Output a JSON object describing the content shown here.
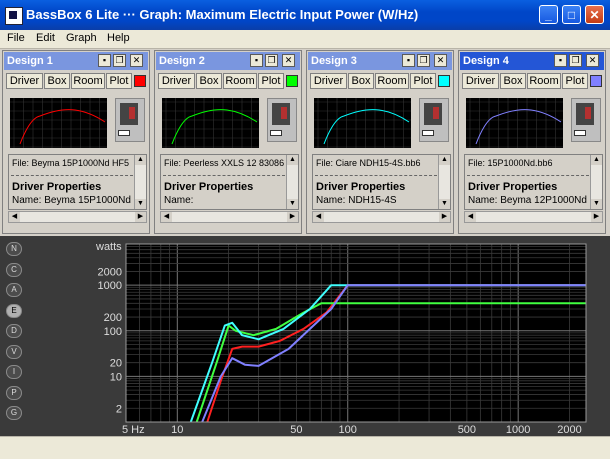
{
  "window": {
    "title": "BassBox 6 Lite ··· Graph: Maximum Electric Input Power (W/Hz)"
  },
  "menu": [
    "File",
    "Edit",
    "Graph",
    "Help"
  ],
  "tabs": [
    "Driver",
    "Box",
    "Room",
    "Plot"
  ],
  "designs": [
    {
      "title": "Design 1",
      "color": "#ff0000",
      "file": "File: Beyma 15P1000Nd HF5",
      "section": "Driver Properties",
      "name": "Name: Beyma 15P1000Nd",
      "active": false
    },
    {
      "title": "Design 2",
      "color": "#00ff00",
      "file": "File: Peerless XXLS 12 83086",
      "section": "Driver Properties",
      "name": "Name:",
      "active": false
    },
    {
      "title": "Design 3",
      "color": "#00ffff",
      "file": "File: Ciare NDH15-4S.bb6",
      "section": "Driver Properties",
      "name": "Name: NDH15-4S",
      "active": false
    },
    {
      "title": "Design 4",
      "color": "#8080ff",
      "file": "File: 15P1000Nd.bb6",
      "section": "Driver Properties",
      "name": "Name: Beyma 12P1000Nd",
      "active": true
    }
  ],
  "side_buttons": [
    "N",
    "C",
    "A",
    "E",
    "D",
    "V",
    "I",
    "P",
    "G"
  ],
  "chart_data": {
    "type": "line",
    "ylabel": "watts",
    "xscale": "log",
    "yscale": "log",
    "xlim": [
      5,
      2500
    ],
    "ylim": [
      1,
      8000
    ],
    "x_ticks": [
      "5 Hz",
      "10",
      "50",
      "100",
      "500",
      "1000",
      "2000"
    ],
    "y_ticks": [
      "2000",
      "1000",
      "200",
      "100",
      "20",
      "10",
      "2"
    ],
    "grid": true,
    "series": [
      {
        "color": "#ff2020",
        "points": [
          [
            15,
            1
          ],
          [
            18,
            8
          ],
          [
            21,
            40
          ],
          [
            24,
            45
          ],
          [
            30,
            45
          ],
          [
            40,
            60
          ],
          [
            55,
            110
          ],
          [
            75,
            250
          ],
          [
            100,
            1000
          ],
          [
            2500,
            1000
          ]
        ]
      },
      {
        "color": "#40ff40",
        "points": [
          [
            13,
            1
          ],
          [
            17,
            20
          ],
          [
            20,
            130
          ],
          [
            22,
            100
          ],
          [
            28,
            80
          ],
          [
            38,
            110
          ],
          [
            55,
            250
          ],
          [
            70,
            400
          ],
          [
            2500,
            400
          ]
        ]
      },
      {
        "color": "#40ffff",
        "points": [
          [
            12,
            1
          ],
          [
            16,
            20
          ],
          [
            19,
            130
          ],
          [
            21,
            150
          ],
          [
            24,
            80
          ],
          [
            30,
            65
          ],
          [
            42,
            110
          ],
          [
            60,
            300
          ],
          [
            80,
            1000
          ],
          [
            100,
            1000
          ],
          [
            2500,
            1000
          ]
        ]
      },
      {
        "color": "#8080ff",
        "points": [
          [
            14,
            1
          ],
          [
            18,
            10
          ],
          [
            21,
            25
          ],
          [
            25,
            18
          ],
          [
            30,
            17
          ],
          [
            45,
            40
          ],
          [
            60,
            110
          ],
          [
            80,
            300
          ],
          [
            100,
            1000
          ],
          [
            2500,
            1000
          ]
        ]
      }
    ]
  }
}
